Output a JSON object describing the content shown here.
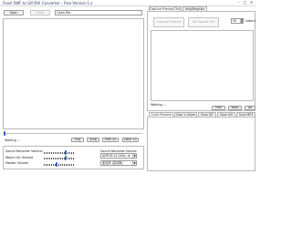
{
  "window": {
    "title": "Flash SWF to GIF/AVI Converter - Free Version 1.x",
    "minimize_glyph": "–",
    "maximize_glyph": "□",
    "close_glyph": "✕"
  },
  "file_bar": {
    "open_label": "Open",
    "close_label": "Close",
    "file_value": "Open file"
  },
  "player": {
    "status": "Waiting ...",
    "play_label": "Play",
    "stop_label": "Stop",
    "prev_label": "Prev 50",
    "next_label": "Next 50"
  },
  "sound": {
    "recorder_volume_label": "Sound Recorder Volume",
    "wave_out_label": "Wave Out Volume",
    "master_label": "Master Volume",
    "device_label": "Sound Recorder Device",
    "device_value": "ADPCM 44.1KHz, st",
    "device2_value": "麦克风 (高清晰)",
    "recorder_volume_level": 0.72,
    "wave_out_level": 0.72,
    "master_level": 0.42
  },
  "right_top_tabs": [
    {
      "label": "Capture Frames/Clicks",
      "active": true
    },
    {
      "label": "Help/Register",
      "active": false
    }
  ],
  "capture": {
    "capture_frames_label": "Capture Frames",
    "set_sound_label": "Set Sound File",
    "spin_value": "50",
    "latency_label": "Latenc",
    "status": "Waiting ...",
    "prev_label": "Prev",
    "next_label": "Next",
    "delete_label": "De"
  },
  "right_bottom_tabs": [
    {
      "label": "Quick Preview",
      "active": true
    },
    {
      "label": "Crop 'n Zoom",
      "active": false
    },
    {
      "label": "Save GIF",
      "active": false
    },
    {
      "label": "Save AVI",
      "active": false
    },
    {
      "label": "Save MP3",
      "active": false
    }
  ]
}
